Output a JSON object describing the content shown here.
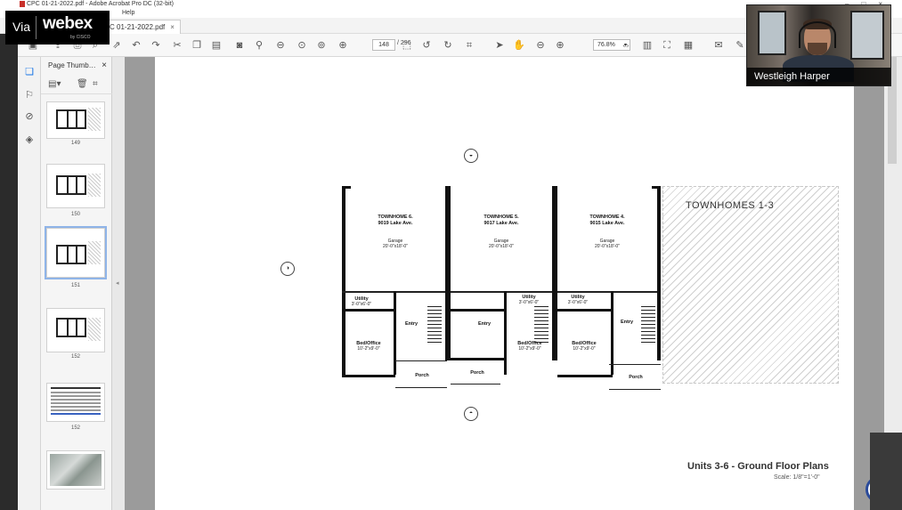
{
  "titlebar": {
    "text": "CPC 01-21-2022.pdf - Adobe Acrobat Pro DC (32-bit)"
  },
  "menubar": {
    "help": "Help"
  },
  "tab": {
    "label": "C 01-21-2022.pdf",
    "close": "×"
  },
  "toolbar": {
    "page_current": "148",
    "page_total": "/ 296",
    "zoom": "76.8%"
  },
  "thumbpane": {
    "title": "Page Thumb…",
    "close": "×",
    "thumbs": [
      "149",
      "150",
      "151",
      "152",
      "152",
      ""
    ]
  },
  "webex": {
    "via": "Via",
    "brand": "webex",
    "by": "by CISCO"
  },
  "participant": {
    "name": "Westleigh Harper"
  },
  "plan": {
    "units": [
      {
        "name": "TOWNHOME 6.",
        "addr": "9019 Lake Ave.",
        "garage": "Garage",
        "garage_dim": "20'-0\"x18'-0\"",
        "utility": "Utility",
        "utility_dim": "3'-0\"x6'-0\"",
        "bed": "Bed/Office",
        "bed_dim": "10'-2\"x9'-0\"",
        "entry": "Entry",
        "porch": "Porch"
      },
      {
        "name": "TOWNHOME 5.",
        "addr": "9017 Lake Ave.",
        "garage": "Garage",
        "garage_dim": "20'-0\"x18'-0\"",
        "utility": "Utility",
        "utility_dim": "3'-0\"x6'-0\"",
        "bed": "Bed/Office",
        "bed_dim": "10'-2\"x9'-0\"",
        "entry": "Entry",
        "porch": "Porch"
      },
      {
        "name": "TOWNHOME 4.",
        "addr": "9015 Lake Ave.",
        "garage": "Garage",
        "garage_dim": "20'-0\"x18'-0\"",
        "utility": "Utility",
        "utility_dim": "3'-0\"x6'-0\"",
        "bed": "Bed/Office",
        "bed_dim": "10'-2\"x9'-0\"",
        "entry": "Entry",
        "porch": "Porch"
      }
    ],
    "townhomes_label": "TOWNHOMES 1-3",
    "sheet_title": "Units 3-6 - Ground Floor Plans",
    "scale": "Scale: 1/8\"=1'-0\""
  },
  "icons": [
    "save-icon",
    "print-icon",
    "search-icon",
    "undo-icon",
    "redo-icon",
    "hand-icon",
    "zoom-in-icon",
    "zoom-out-icon",
    "comment-icon",
    "pen-icon"
  ]
}
